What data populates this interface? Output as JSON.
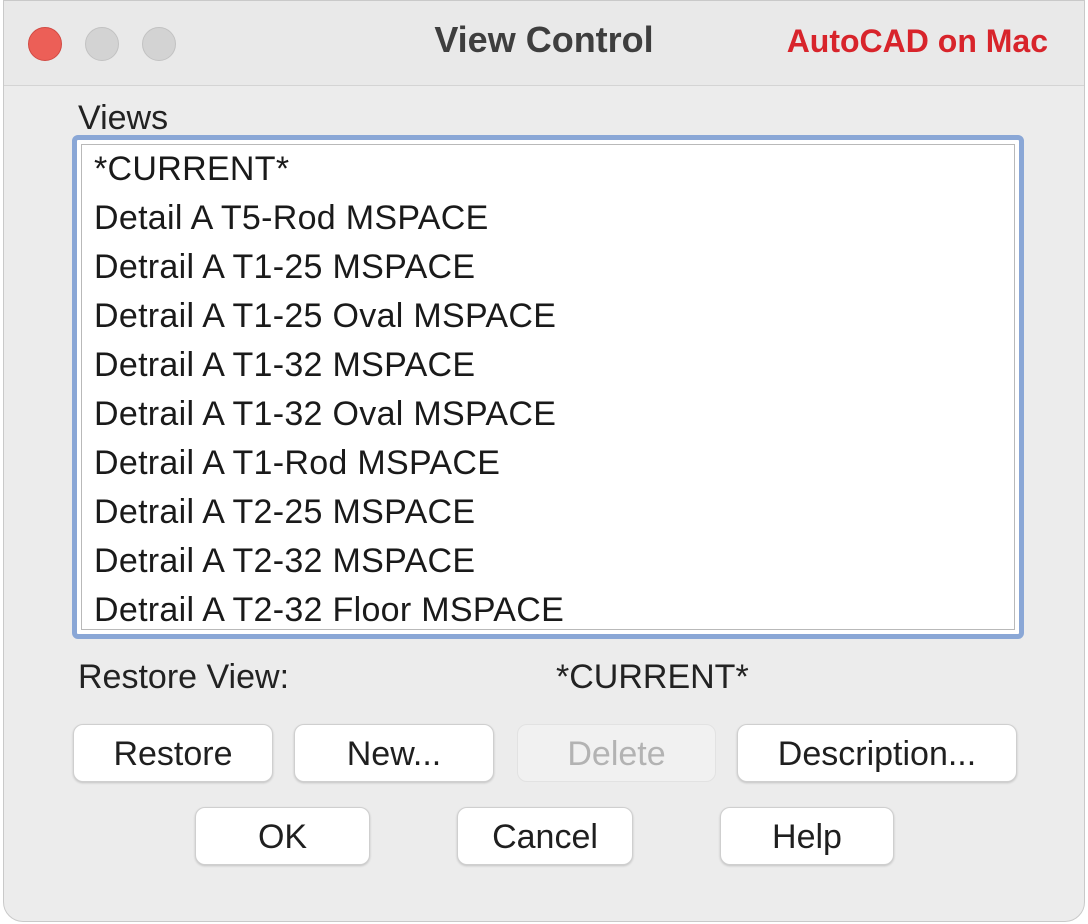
{
  "window": {
    "title": "View Control",
    "brand": "AutoCAD on Mac"
  },
  "views": {
    "label": "Views",
    "items": [
      "*CURRENT*",
      "Detail A T5-Rod MSPACE",
      "Detrail A T1-25 MSPACE",
      "Detrail A T1-25 Oval MSPACE",
      "Detrail A T1-32 MSPACE",
      "Detrail A T1-32 Oval MSPACE",
      "Detrail A T1-Rod MSPACE",
      "Detrail A T2-25 MSPACE",
      "Detrail A T2-32 MSPACE",
      "Detrail A T2-32 Floor MSPACE"
    ]
  },
  "restore": {
    "label": "Restore View:",
    "value": "*CURRENT*"
  },
  "buttons": {
    "restore": "Restore",
    "new": "New...",
    "delete": "Delete",
    "description": "Description...",
    "ok": "OK",
    "cancel": "Cancel",
    "help": "Help"
  },
  "colors": {
    "brand": "#d8242b",
    "close": "#ec5f57",
    "list_focus": "#8aa7d6"
  }
}
